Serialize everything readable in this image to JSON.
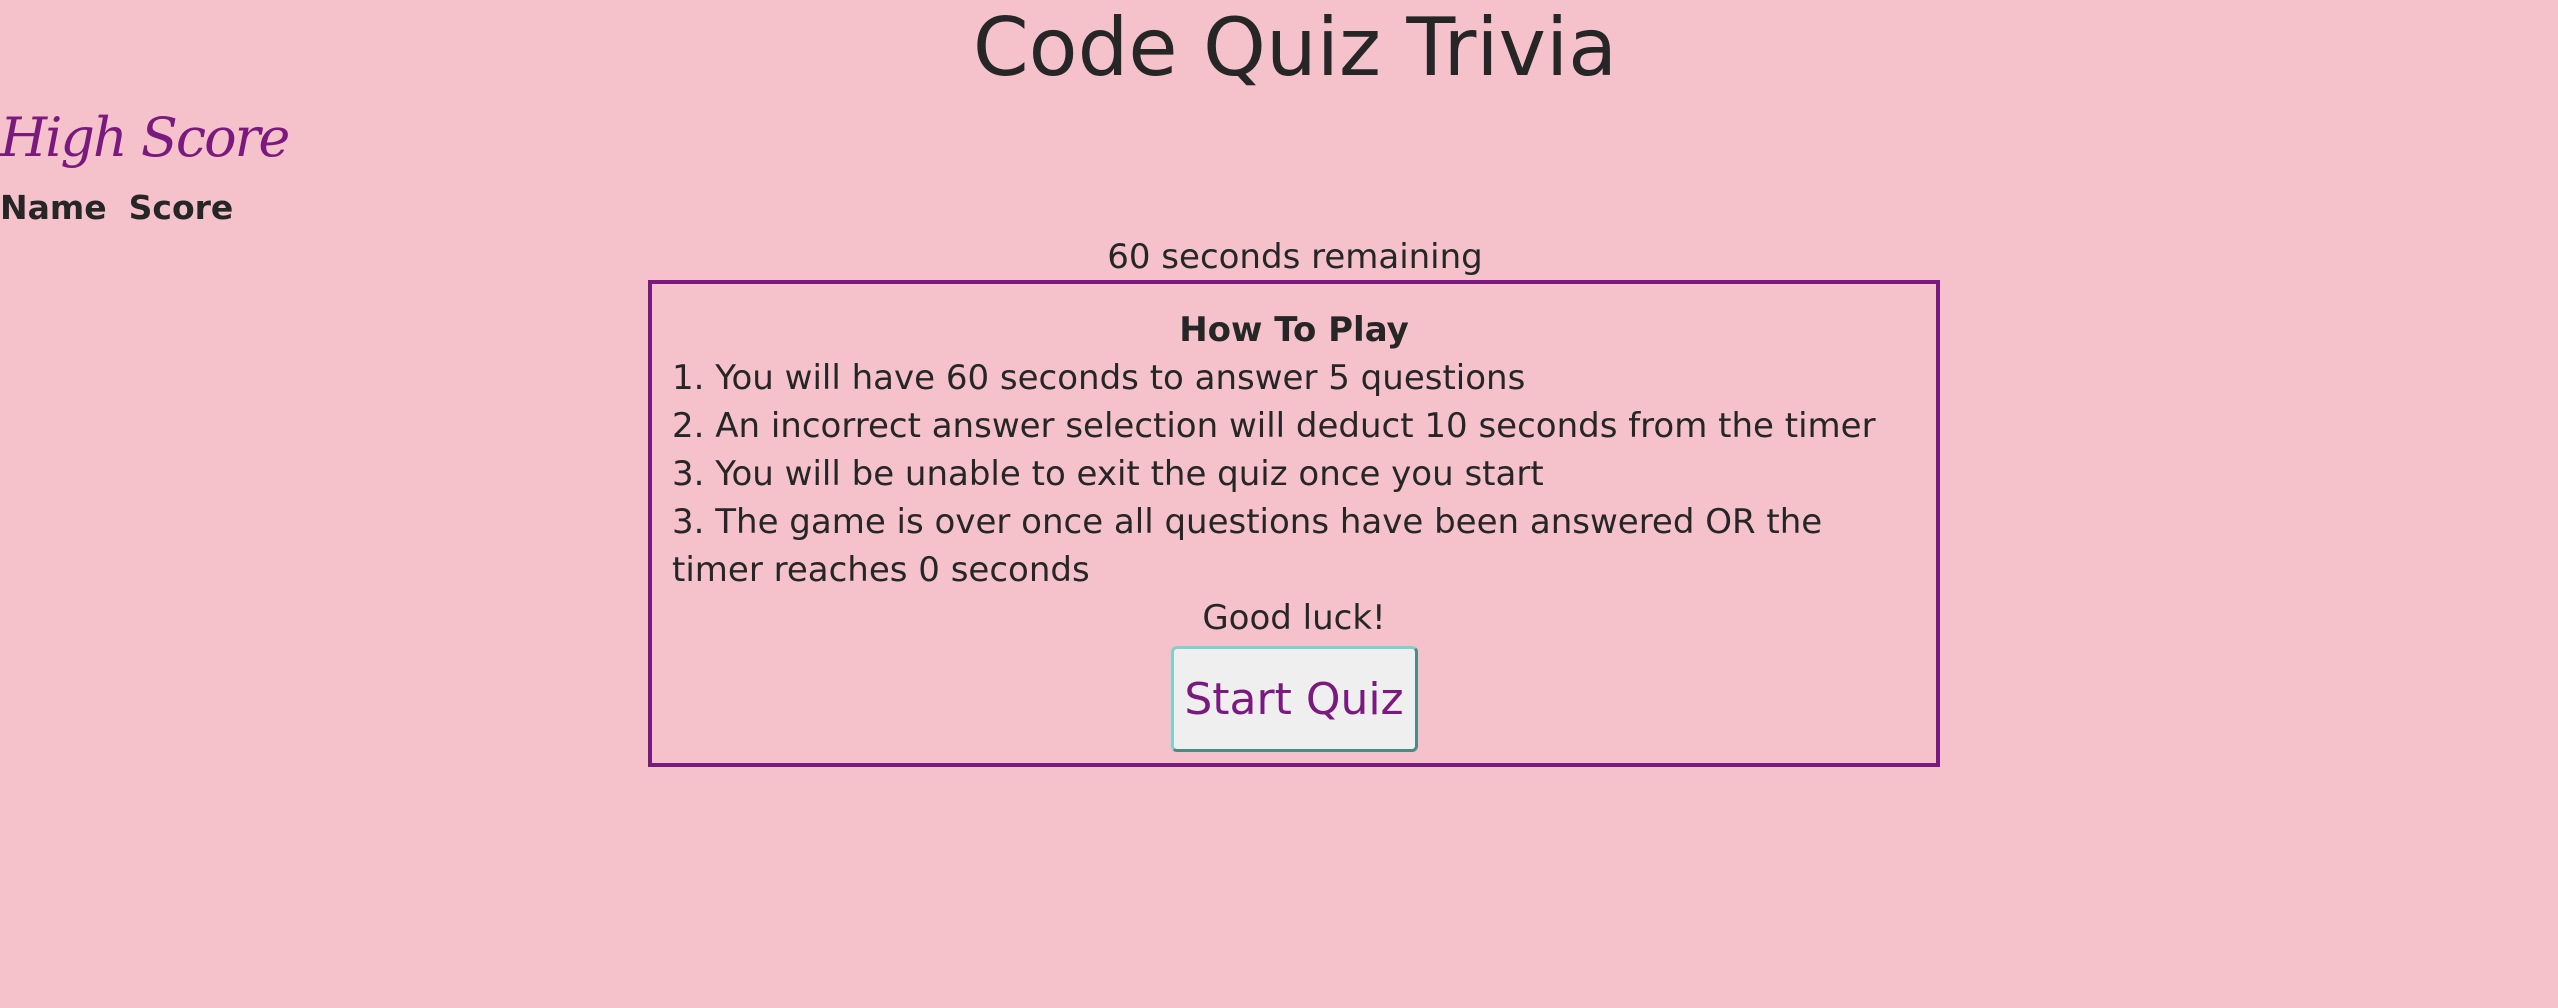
{
  "header": {
    "title": "Code Quiz Trivia"
  },
  "highscore": {
    "title": "High Score",
    "columns": [
      "Name",
      "Score"
    ]
  },
  "timer": {
    "text": "60 seconds remaining"
  },
  "instructions": {
    "heading": "How To Play",
    "rules": [
      "1. You will have 60 seconds to answer 5 questions",
      "2. An incorrect answer selection will deduct 10 seconds from the timer",
      "3. You will be unable to exit the quiz once you start",
      "3. The game is over once all questions have been answered OR the timer reaches 0 seconds"
    ],
    "closing": "Good luck!",
    "start_label": "Start Quiz"
  },
  "colors": {
    "background": "#f5c2cc",
    "accent": "#7a1a7e",
    "button_border": "#7fd1cb"
  }
}
